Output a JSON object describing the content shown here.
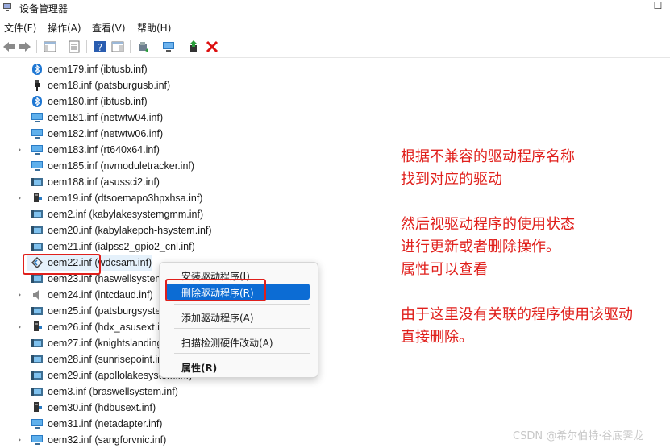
{
  "window": {
    "title": "设备管理器",
    "minimize": "–",
    "maximize": "☐"
  },
  "menu": [
    "文件(F)",
    "操作(A)",
    "查看(V)",
    "帮助(H)"
  ],
  "tree_rows": [
    {
      "label": "oem179.inf (ibtusb.inf)",
      "icon": "bluetooth-icon",
      "expandable": false
    },
    {
      "label": "oem18.inf (patsburgusb.inf)",
      "icon": "usb-plug-icon",
      "expandable": false
    },
    {
      "label": "oem180.inf (ibtusb.inf)",
      "icon": "bluetooth-icon",
      "expandable": false
    },
    {
      "label": "oem181.inf (netwtw04.inf)",
      "icon": "network-monitor-icon",
      "expandable": false
    },
    {
      "label": "oem182.inf (netwtw06.inf)",
      "icon": "network-monitor-icon",
      "expandable": false
    },
    {
      "label": "oem183.inf (rt640x64.inf)",
      "icon": "network-monitor-icon",
      "expandable": true
    },
    {
      "label": "oem185.inf (nvmoduletracker.inf)",
      "icon": "network-monitor-icon",
      "expandable": false
    },
    {
      "label": "oem188.inf (asussci2.inf)",
      "icon": "device-icon",
      "expandable": false
    },
    {
      "label": "oem19.inf (dtsoemapo3hpxhsa.inf)",
      "icon": "audio-device-icon",
      "expandable": true
    },
    {
      "label": "oem2.inf (kabylakesystemgmm.inf)",
      "icon": "device-icon",
      "expandable": false
    },
    {
      "label": "oem20.inf (kabylakepch-hsystem.inf)",
      "icon": "device-icon",
      "expandable": false
    },
    {
      "label": "oem21.inf (ialpss2_gpio2_cnl.inf)",
      "icon": "device-icon",
      "expandable": false
    },
    {
      "label": "oem22.inf (wdcsam.inf)",
      "icon": "sensor-icon",
      "expandable": false,
      "selected": true
    },
    {
      "label": "oem23.inf (haswellsystem.inf)",
      "icon": "device-icon",
      "expandable": false
    },
    {
      "label": "oem24.inf (intcdaud.inf)",
      "icon": "speaker-icon",
      "expandable": true
    },
    {
      "label": "oem25.inf (patsburgsystem.inf)",
      "icon": "device-icon",
      "expandable": false
    },
    {
      "label": "oem26.inf (hdx_asusext.inf)",
      "icon": "audio-device-icon",
      "expandable": true
    },
    {
      "label": "oem27.inf (knightslanding.inf)",
      "icon": "device-icon",
      "expandable": false
    },
    {
      "label": "oem28.inf (sunrisepoint.inf)",
      "icon": "device-icon",
      "expandable": false
    },
    {
      "label": "oem29.inf (apollolakesystem.inf)",
      "icon": "device-icon",
      "expandable": false
    },
    {
      "label": "oem3.inf (braswellsystem.inf)",
      "icon": "device-icon",
      "expandable": false
    },
    {
      "label": "oem30.inf (hdbusext.inf)",
      "icon": "audio-device-icon",
      "expandable": false
    },
    {
      "label": "oem31.inf (netadapter.inf)",
      "icon": "network-monitor-icon",
      "expandable": false
    },
    {
      "label": "oem32.inf (sangforvnic.inf)",
      "icon": "network-monitor-icon",
      "expandable": true
    }
  ],
  "context_menu": {
    "install": "安装驱动程序(I)",
    "uninstall": "删除驱动程序(R)",
    "add": "添加驱动程序(A)",
    "scan": "扫描检测硬件改动(A)",
    "properties": "属性(R)"
  },
  "annotations": [
    "根据不兼容的驱动程序名称",
    "找到对应的驱动",
    "然后视驱动程序的使用状态",
    "进行更新或者删除操作。",
    "属性可以查看",
    "由于这里没有关联的程序使用该驱动",
    "直接删除。"
  ],
  "watermark": "CSDN @希尔伯特·谷底霁龙",
  "colors": {
    "annotation": "#e0201c",
    "highlight": "#0c6cd4",
    "selection": "#e5f1fb"
  }
}
